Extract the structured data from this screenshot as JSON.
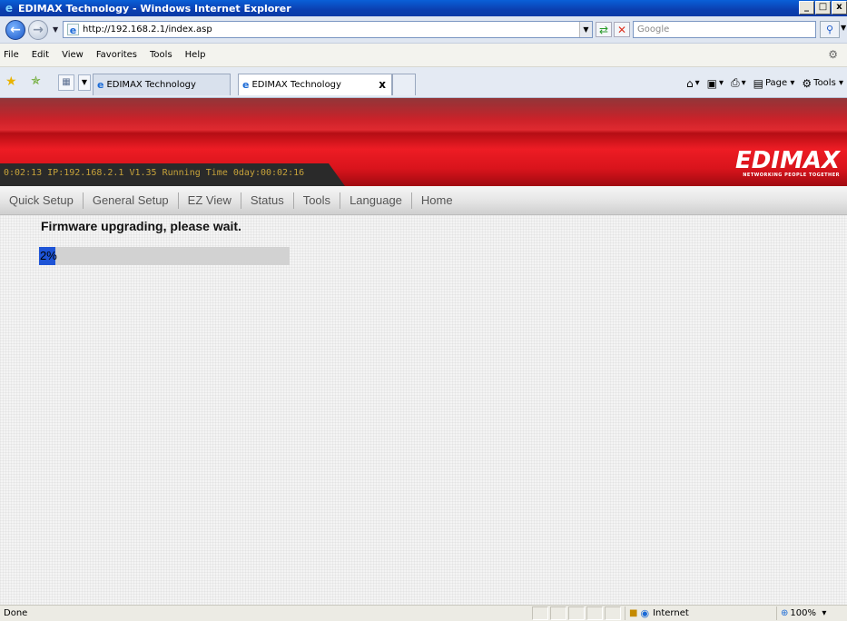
{
  "window": {
    "title": "EDIMAX Technology - Windows Internet Explorer",
    "controls": [
      "_",
      "□",
      "x"
    ]
  },
  "address": {
    "url": "http://192.168.2.1/index.asp",
    "search_placeholder": "Google"
  },
  "menu": {
    "items": [
      "File",
      "Edit",
      "View",
      "Favorites",
      "Tools",
      "Help"
    ]
  },
  "tabs": {
    "items": [
      {
        "label": "EDIMAX Technology",
        "active": false
      },
      {
        "label": "EDIMAX Technology",
        "active": true
      }
    ],
    "close_label": "x"
  },
  "command_bar": {
    "page_label": "Page",
    "tools_label": "Tools"
  },
  "router": {
    "status_line": "0:02:13   IP:192.168.2.1   V1.35   Running Time 0day:00:02:16",
    "logo": "EDIMAX",
    "tagline": "NETWORKING PEOPLE TOGETHER",
    "nav": [
      "Quick Setup",
      "General Setup",
      "EZ View",
      "Status",
      "Tools",
      "Language",
      "Home"
    ],
    "message": "Firmware upgrading, please wait.",
    "progress_percent": 2,
    "progress_label": "2%"
  },
  "statusbar": {
    "status": "Done",
    "zone": "Internet",
    "zoom": "100%"
  },
  "colors": {
    "banner_red": "#ed1c24",
    "progress_blue": "#1e54d6",
    "title_blue": "#0b3fb0"
  }
}
